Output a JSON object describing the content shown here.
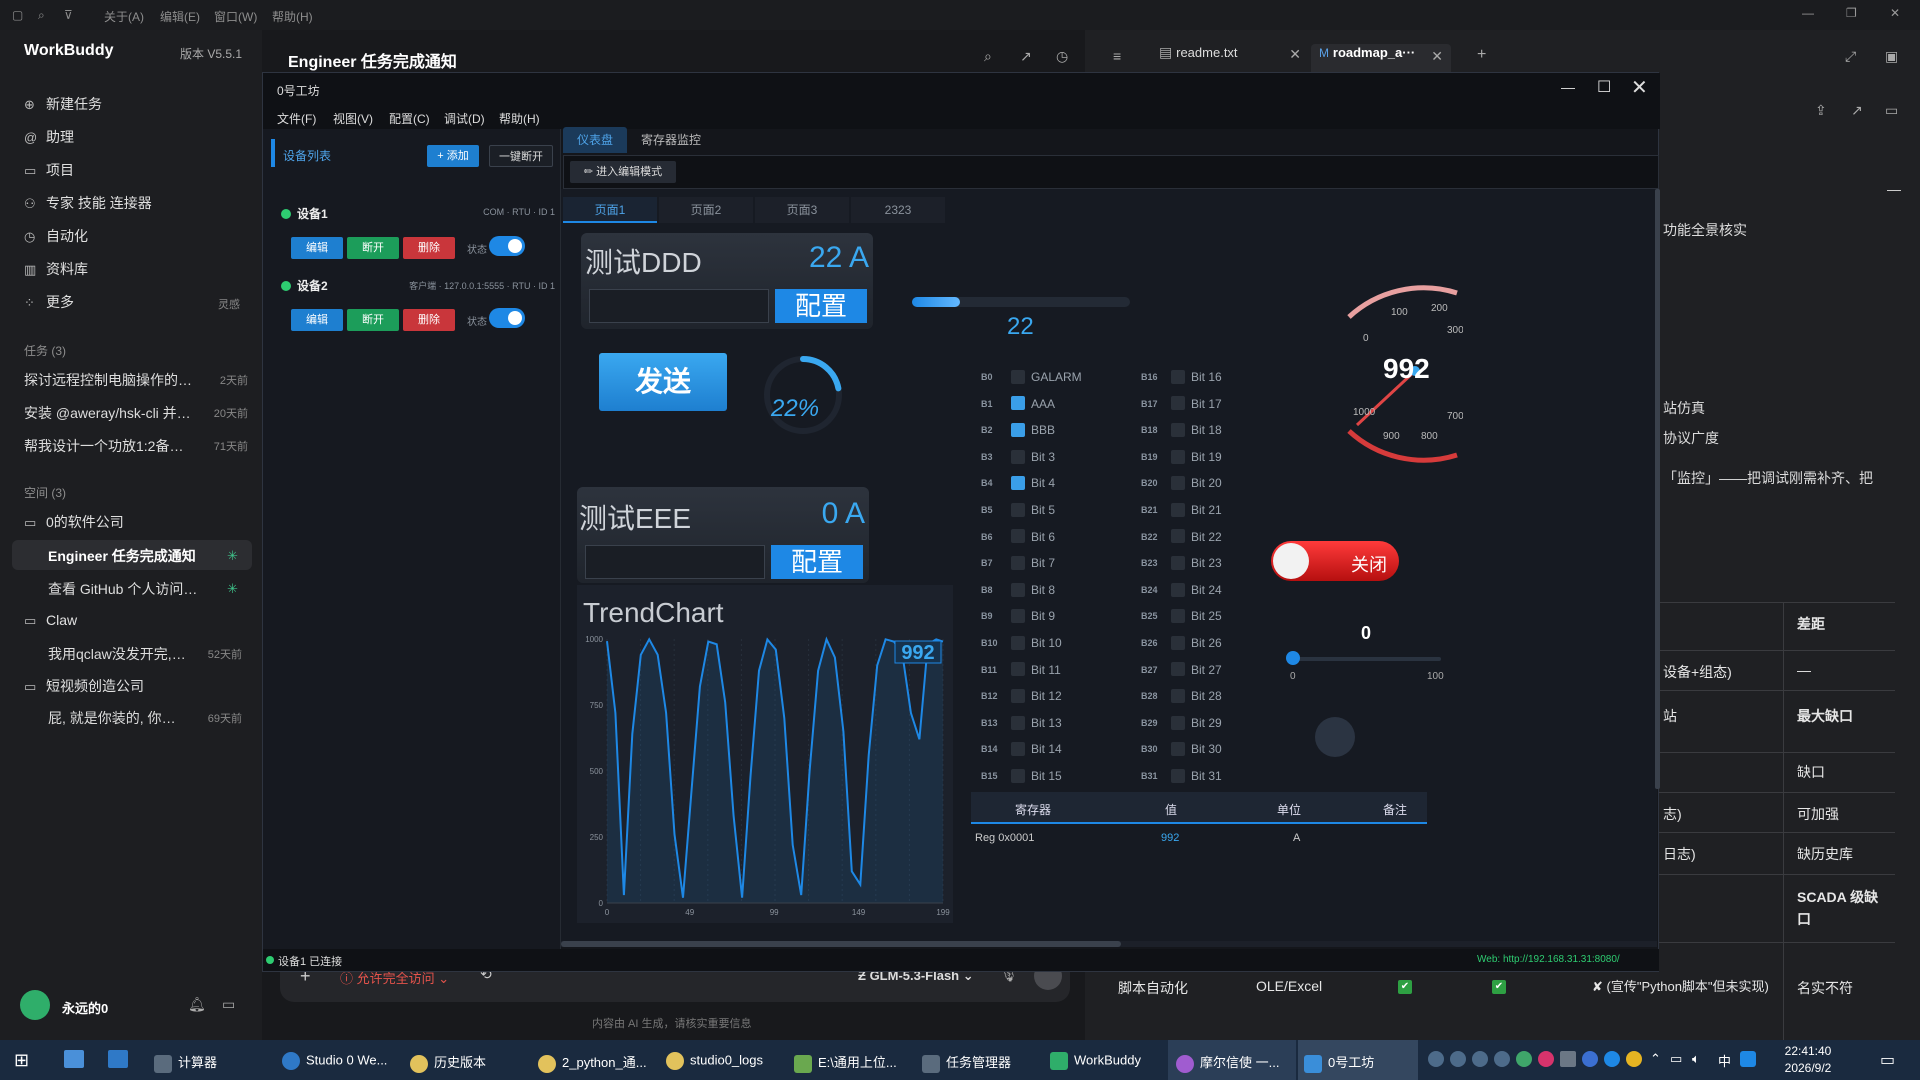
{
  "menubar": {
    "items": [
      "关于(A)",
      "编辑(E)",
      "窗口(W)",
      "帮助(H)"
    ]
  },
  "sidebar": {
    "app_name": "WorkBuddy",
    "version": "版本 V5.5.1",
    "nav": [
      {
        "icon": "plus-circle-icon",
        "label": "新建任务"
      },
      {
        "icon": "at-icon",
        "label": "助理"
      },
      {
        "icon": "folder-icon",
        "label": "项目"
      },
      {
        "icon": "connector-icon",
        "label": "专家 技能 连接器"
      },
      {
        "icon": "clock-icon",
        "label": "自动化"
      },
      {
        "icon": "book-icon",
        "label": "资料库"
      },
      {
        "icon": "grid-icon",
        "label": "更多",
        "badge": "灵感"
      }
    ],
    "tasks_header": "任务 (3)",
    "tasks": [
      {
        "title": "探讨远程控制电脑操作的…",
        "ago": "2天前"
      },
      {
        "title": "安装 @aweray/hsk-cli 并…",
        "ago": "20天前"
      },
      {
        "title": "帮我设计一个功放1:2备份…",
        "ago": "71天前"
      }
    ],
    "spaces_header": "空间 (3)",
    "spaces": [
      {
        "name": "0的软件公司",
        "items": [
          {
            "title": "Engineer 任务完成通知",
            "active": true
          },
          {
            "title": "查看 GitHub 个人访问…",
            "active": false
          }
        ]
      },
      {
        "name": "Claw",
        "items": [
          {
            "title": "我用qclaw没发开完, …",
            "ago": "52天前"
          }
        ]
      },
      {
        "name": "短视频创造公司",
        "items": [
          {
            "title": "屁, 就是你装的, 你认…",
            "ago": "69天前"
          }
        ]
      }
    ],
    "user": "永远的0"
  },
  "chat": {
    "title": "Engineer 任务完成通知",
    "permission": "允许完全访问",
    "model": "GLM-5.3-Flash",
    "footer": "内容由 AI 生成，请核实重要信息"
  },
  "editor": {
    "tabs": [
      {
        "label": "readme.txt"
      },
      {
        "label": "roadmap_a···"
      }
    ],
    "doc_lines": [
      "功能全景核实",
      "站仿真",
      "协议广度",
      "「监控」——把调试刚需补齐、把"
    ],
    "table": {
      "header": "差距",
      "rows": [
        {
          "c1": "设备+组态)",
          "c2": "—"
        },
        {
          "c1": "站",
          "c2": "最大缺口"
        },
        {
          "c1": "",
          "c2": "缺口"
        },
        {
          "c1": "志)",
          "c2": "可加强"
        },
        {
          "c1": "日志)",
          "c2": "缺历史库"
        },
        {
          "c1": "",
          "c2": "SCADA 级缺口"
        }
      ],
      "last_row": [
        "脚本自动化",
        "OLE/Excel",
        "✔",
        "✔",
        "✘ (宣传\"Python脚本\"但未实现)",
        "名实不符"
      ]
    }
  },
  "app": {
    "title": "0号工坊",
    "menu": [
      "文件(F)",
      "视图(V)",
      "配置(C)",
      "调试(D)",
      "帮助(H)"
    ],
    "device_panel": {
      "title": "设备列表",
      "add": "+ 添加",
      "disconnect_all": "一键断开"
    },
    "tabs": [
      "仪表盘",
      "寄存器监控"
    ],
    "edit_mode": "✏ 进入编辑模式",
    "pages": [
      "页面1",
      "页面2",
      "页面3",
      "2323"
    ],
    "devices": [
      {
        "name": "设备1",
        "info": "COM · RTU · ID 1",
        "btn_edit": "编辑",
        "btn_disc": "断开",
        "btn_del": "删除",
        "state": "状态"
      },
      {
        "name": "设备2",
        "info": "客户端 · 127.0.0.1:5555 · RTU · ID 1",
        "btn_edit": "编辑",
        "btn_disc": "断开",
        "btn_del": "删除",
        "state": "状态"
      }
    ],
    "card1": {
      "name": "测试DDD",
      "value": "22 A",
      "btn": "配置"
    },
    "card2": {
      "name": "测试EEE",
      "value": "0 A",
      "btn": "配置"
    },
    "send": "发送",
    "ring": {
      "label": "22%",
      "fraction": 0.22
    },
    "progress": {
      "label": "22",
      "fraction": 0.22
    },
    "gauge": {
      "value": "992",
      "ticks": [
        "0",
        "100",
        "200",
        "300",
        "700",
        "800",
        "900",
        "1000"
      ]
    },
    "switch_label": "关闭",
    "slider": {
      "value": "0",
      "min": "0",
      "max": "100"
    },
    "bits_left": [
      [
        "B0",
        "GALARM",
        false
      ],
      [
        "B1",
        "AAA",
        true
      ],
      [
        "B2",
        "BBB",
        true
      ],
      [
        "B3",
        "Bit 3",
        false
      ],
      [
        "B4",
        "Bit 4",
        true
      ],
      [
        "B5",
        "Bit 5",
        false
      ],
      [
        "B6",
        "Bit 6",
        false
      ],
      [
        "B7",
        "Bit 7",
        false
      ],
      [
        "B8",
        "Bit 8",
        false
      ],
      [
        "B9",
        "Bit 9",
        false
      ],
      [
        "B10",
        "Bit 10",
        false
      ],
      [
        "B11",
        "Bit 11",
        false
      ],
      [
        "B12",
        "Bit 12",
        false
      ],
      [
        "B13",
        "Bit 13",
        false
      ],
      [
        "B14",
        "Bit 14",
        false
      ],
      [
        "B15",
        "Bit 15",
        false
      ]
    ],
    "bits_right": [
      [
        "B16",
        "Bit 16"
      ],
      [
        "B17",
        "Bit 17"
      ],
      [
        "B18",
        "Bit 18"
      ],
      [
        "B19",
        "Bit 19"
      ],
      [
        "B20",
        "Bit 20"
      ],
      [
        "B21",
        "Bit 21"
      ],
      [
        "B22",
        "Bit 22"
      ],
      [
        "B23",
        "Bit 23"
      ],
      [
        "B24",
        "Bit 24"
      ],
      [
        "B25",
        "Bit 25"
      ],
      [
        "B26",
        "Bit 26"
      ],
      [
        "B27",
        "Bit 27"
      ],
      [
        "B28",
        "Bit 28"
      ],
      [
        "B29",
        "Bit 29"
      ],
      [
        "B30",
        "Bit 30"
      ],
      [
        "B31",
        "Bit 31"
      ]
    ],
    "reg_table": {
      "headers": [
        "寄存器",
        "值",
        "单位",
        "备注"
      ],
      "row": [
        "Reg 0x0001",
        "992",
        "A",
        ""
      ]
    },
    "status_left": "设备1 已连接",
    "status_right": "Web: http://192.168.31.31:8080/"
  },
  "chart_data": {
    "type": "line",
    "title": "TrendChart",
    "x": [
      0,
      5,
      10,
      15,
      20,
      25,
      30,
      35,
      40,
      45,
      50,
      55,
      60,
      65,
      70,
      75,
      80,
      85,
      90,
      95,
      100,
      105,
      110,
      115,
      120,
      125,
      130,
      135,
      140,
      145,
      150,
      155,
      160,
      165,
      170,
      175,
      180,
      185,
      190,
      195,
      199
    ],
    "y": [
      992,
      720,
      30,
      640,
      940,
      999,
      940,
      720,
      260,
      20,
      420,
      820,
      990,
      980,
      760,
      330,
      20,
      480,
      880,
      998,
      960,
      700,
      220,
      30,
      500,
      880,
      999,
      930,
      650,
      120,
      70,
      560,
      900,
      999,
      990,
      940,
      720,
      620,
      980,
      999,
      990
    ],
    "xticks": [
      "0",
      "49",
      "99",
      "149",
      "199"
    ],
    "yticks": [
      "0",
      "250",
      "500",
      "750",
      "1000"
    ],
    "ylim": [
      0,
      1000
    ],
    "current_label": "992"
  },
  "taskbar": {
    "items": [
      "计算器",
      "Studio 0 We...",
      "历史版本",
      "2_python_通...",
      "studio0_logs",
      "E:\\通用上位...",
      "任务管理器",
      "WorkBuddy",
      "摩尔信使 一...",
      "0号工坊"
    ],
    "time": "22:41:40",
    "date": "2026/9/2",
    "ime": "中"
  }
}
